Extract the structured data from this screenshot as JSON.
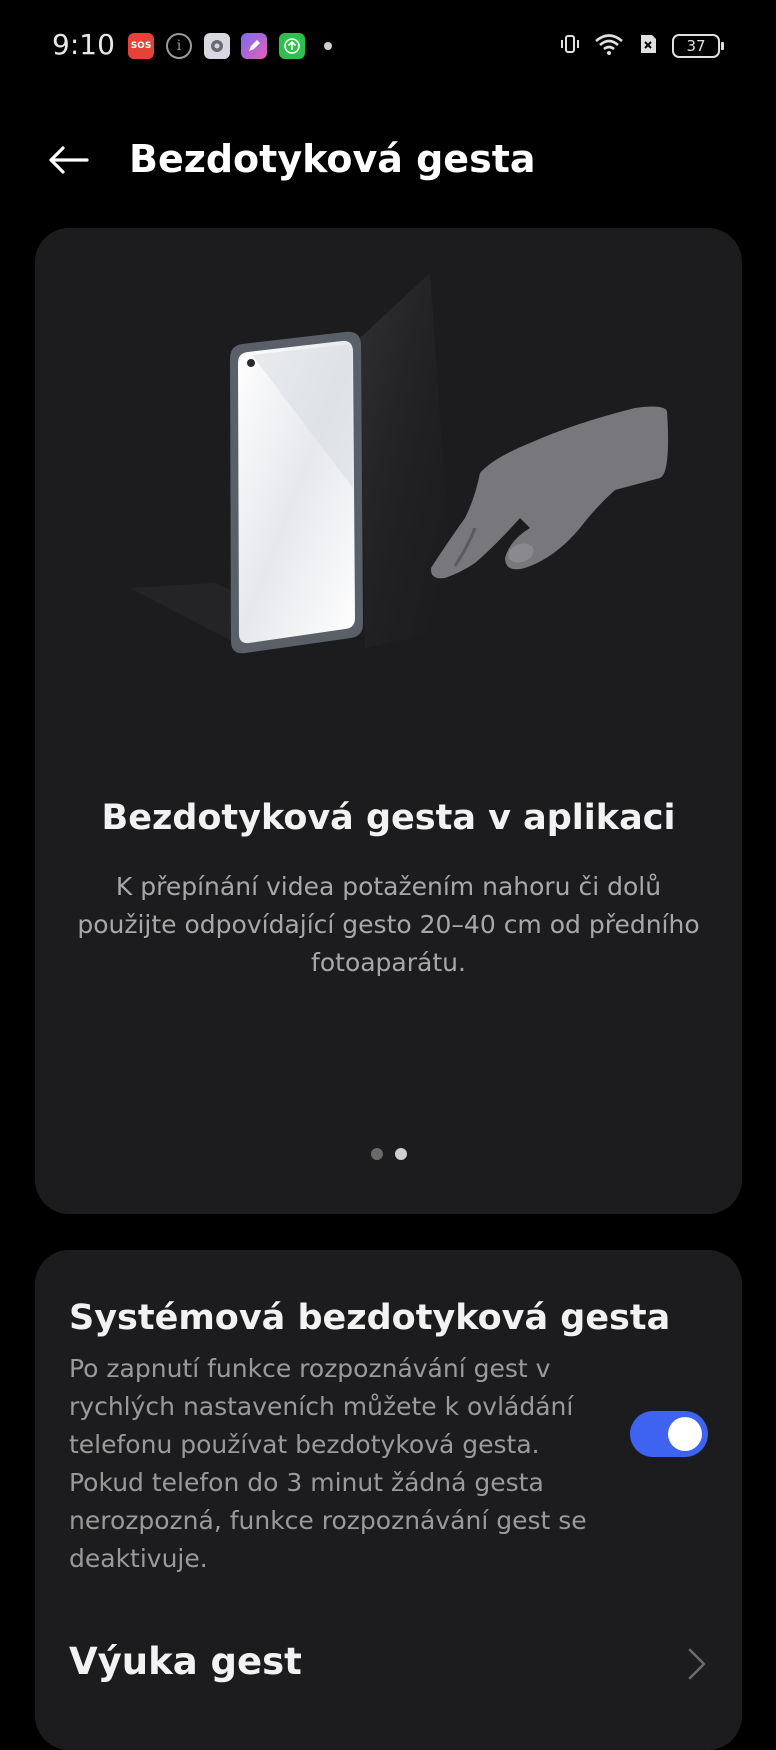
{
  "status_bar": {
    "time": "9:10",
    "sos_label": "SOS",
    "info_label": "i",
    "battery": "37",
    "icons": [
      "sos-icon",
      "info-icon",
      "settings-app-icon",
      "pen-app-icon",
      "upload-app-icon",
      "more-dot-icon",
      "vibrate-icon",
      "wifi-icon",
      "no-sim-icon",
      "battery-icon"
    ]
  },
  "header": {
    "title": "Bezdotyková gesta",
    "back_icon": "arrow-left-icon"
  },
  "intro": {
    "title": "Bezdotyková gesta v aplikaci",
    "description": "K přepínání videa potažením nahoru či dolů použijte odpovídající gesto 20–40 cm od předního fotoaparátu.",
    "page_count": 2,
    "active_page": 2
  },
  "system_gestures": {
    "title": "Systémová bezdotyková gesta",
    "description": "Po zapnutí funkce rozpoznávání gest v rychlých nastaveních můžete k ovládání telefonu používat bezdotyková gesta. Pokud telefon do 3 minut žádná gesta nerozpozná, funkce rozpoznávání gest se deaktivuje.",
    "enabled": true
  },
  "tutorial": {
    "label": "Výuka gest",
    "icon": "chevron-right-icon"
  },
  "colors": {
    "background": "#000000",
    "card": "#1c1c1e",
    "accent": "#3d63f0"
  }
}
